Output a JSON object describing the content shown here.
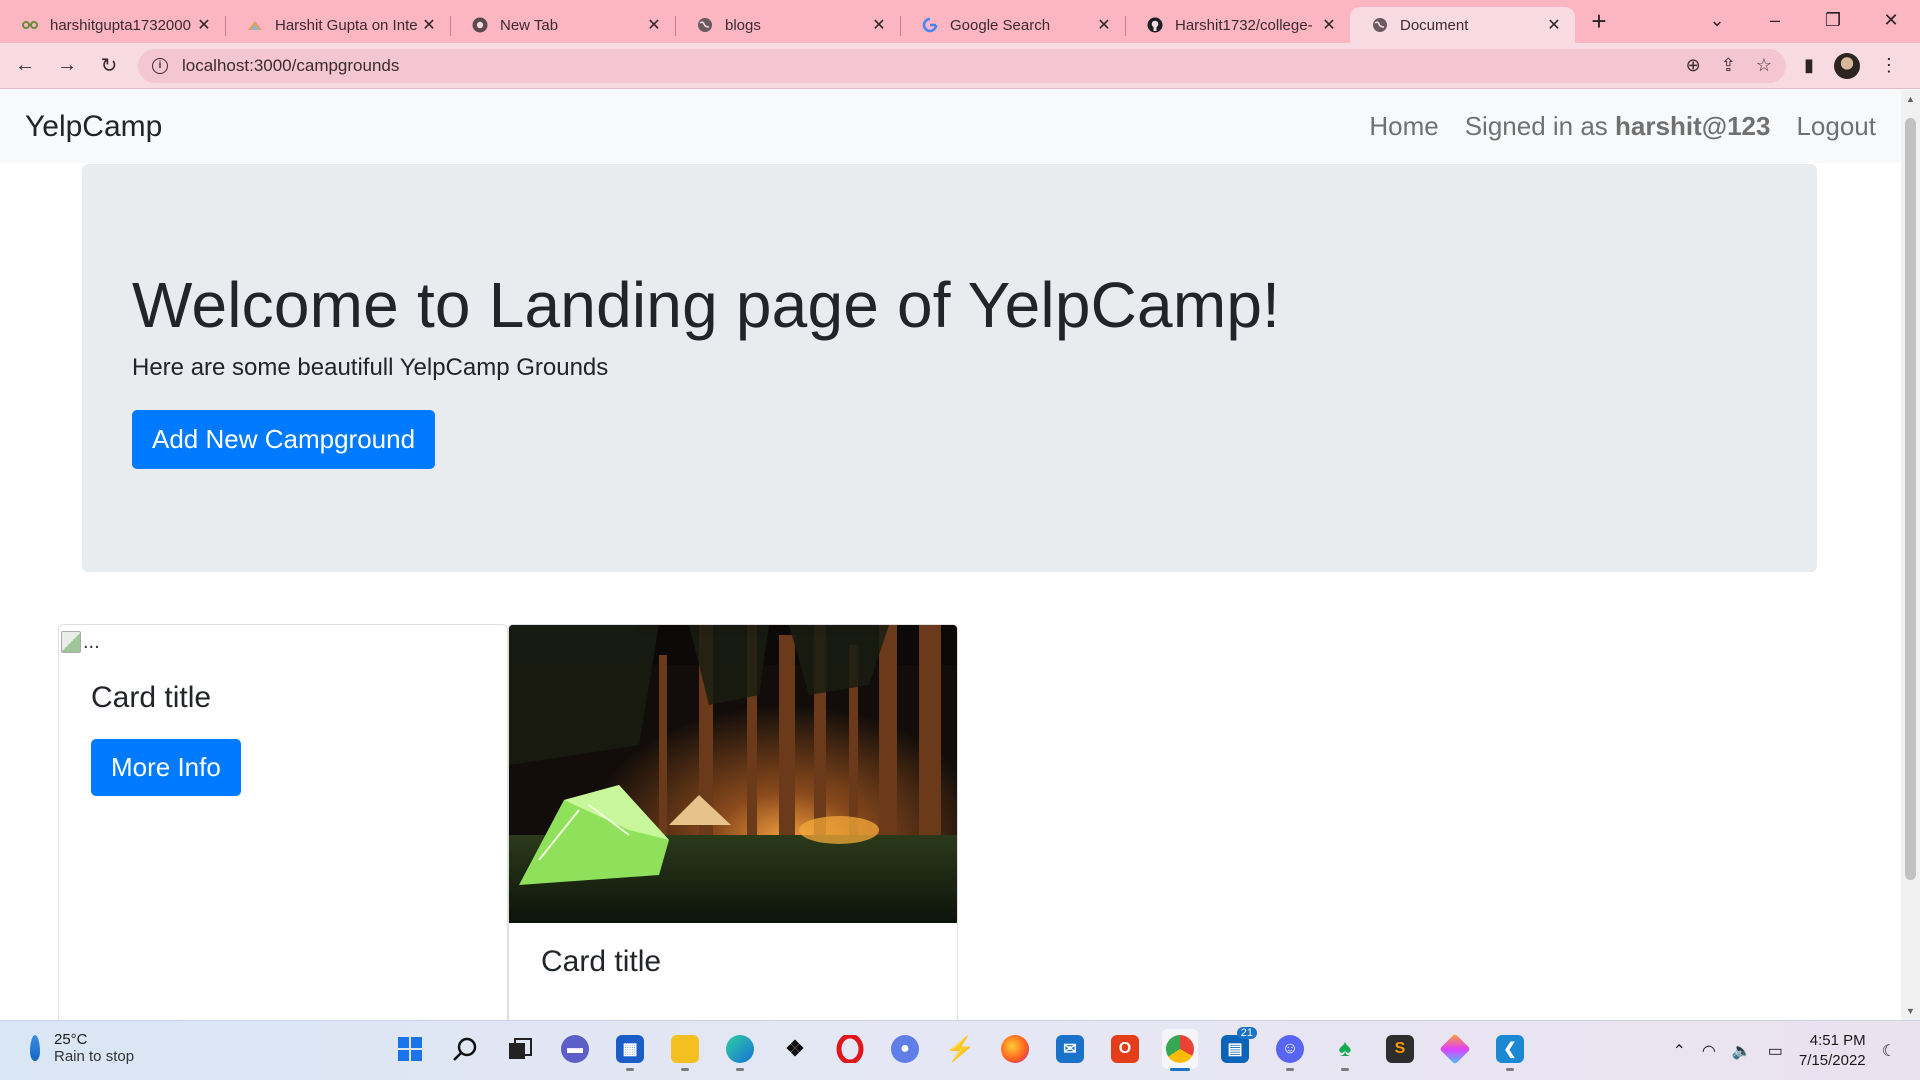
{
  "browser": {
    "tabs": [
      {
        "title": "harshitgupta1732000",
        "icon": "link-icon",
        "active": false
      },
      {
        "title": "Harshit Gupta on Inte",
        "icon": "site-icon",
        "active": false
      },
      {
        "title": "New Tab",
        "icon": "chrome-icon",
        "active": false
      },
      {
        "title": "blogs",
        "icon": "globe-icon",
        "active": false
      },
      {
        "title": "Google Search",
        "icon": "google-icon",
        "active": false
      },
      {
        "title": "Harshit1732/college-",
        "icon": "github-icon",
        "active": false
      },
      {
        "title": "Document",
        "icon": "globe-icon",
        "active": true
      }
    ],
    "url": "localhost:3000/campgrounds",
    "tab_color": "#fbb6c2",
    "toolbar_color": "#f8dbe2"
  },
  "navbar": {
    "brand": "YelpCamp",
    "home": "Home",
    "signed_in_prefix": "Signed in as",
    "username": "harshit@123",
    "logout": "Logout"
  },
  "hero": {
    "title": "Welcome to Landing page of YelpCamp!",
    "subtitle": "Here are some beautifull YelpCamp Grounds",
    "button": "Add New Campground"
  },
  "cards": [
    {
      "image_alt": "...",
      "title": "Card title",
      "button": "More Info"
    },
    {
      "image": "camping-tent-photo",
      "title": "Card title"
    }
  ],
  "taskbar": {
    "temperature": "25°C",
    "weather": "Rain to stop",
    "time": "4:51 PM",
    "date": "7/15/2022",
    "badge_count": "21"
  },
  "colors": {
    "primary": "#007bff",
    "jumbotron": "#e9ecef",
    "navbar": "#f8f9fa"
  }
}
